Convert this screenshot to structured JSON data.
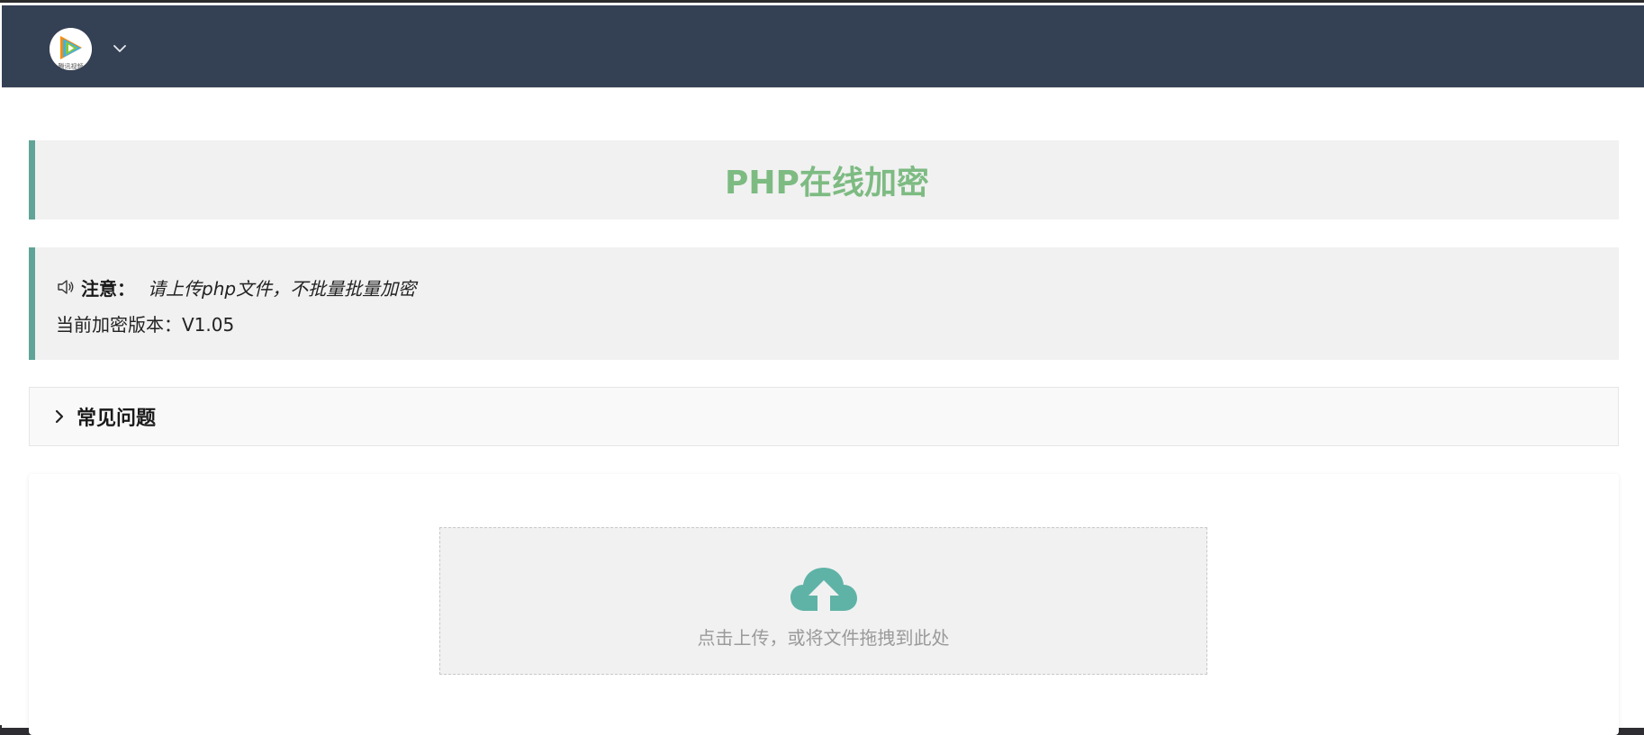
{
  "header": {
    "logo_text": "腾讯视频",
    "logo_icon": "play-logo-icon",
    "menu_icon": "chevron-down-icon"
  },
  "title_block": {
    "title": "PHP在线加密"
  },
  "notice": {
    "icon": "speaker-icon",
    "label": "注意：",
    "message": "请上传php文件，不批量批量加密",
    "version_text": "当前加密版本：V1.05"
  },
  "faq": {
    "icon": "chevron-right-icon",
    "title": "常见问题"
  },
  "upload": {
    "icon": "cloud-upload-icon",
    "hint": "点击上传，或将文件拖拽到此处"
  },
  "colors": {
    "topbar_bg": "#344054",
    "accent_border": "#5fa496",
    "title_green": "#7dbb82",
    "panel_bg": "#f1f1f1",
    "upload_icon": "#5fb3a6"
  }
}
